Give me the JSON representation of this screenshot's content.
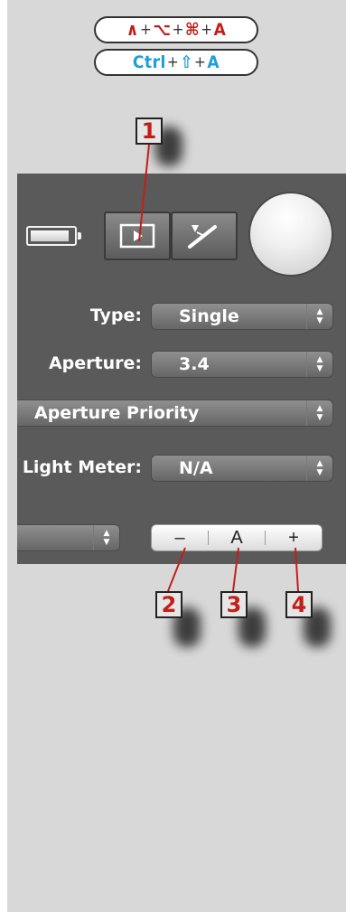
{
  "shortcuts": {
    "mac": {
      "keys": [
        "∧",
        "⌥",
        "⌘",
        "A"
      ],
      "plus": "+"
    },
    "win": {
      "keys": [
        "Ctrl",
        "⇧",
        "A"
      ],
      "plus": "+"
    }
  },
  "callouts": [
    "1",
    "2",
    "3",
    "4"
  ],
  "panel": {
    "battery_level": 0.8,
    "type": {
      "label": "Type:",
      "value": "Single"
    },
    "aperture": {
      "label": "Aperture:",
      "value": "3.4"
    },
    "mode": {
      "value": "Aperture Priority"
    },
    "light_meter": {
      "label": "Light Meter:",
      "value": "N/A"
    },
    "stepper": {
      "minus": "–",
      "auto": "A",
      "plus": "+"
    },
    "arrow_up": "▲",
    "arrow_down": "▼"
  },
  "colors": {
    "mac_key": "#c21f1a",
    "win_key": "#1a9fd6",
    "panel_bg": "#5a5a5a",
    "page_bg": "#d8d8d8"
  }
}
